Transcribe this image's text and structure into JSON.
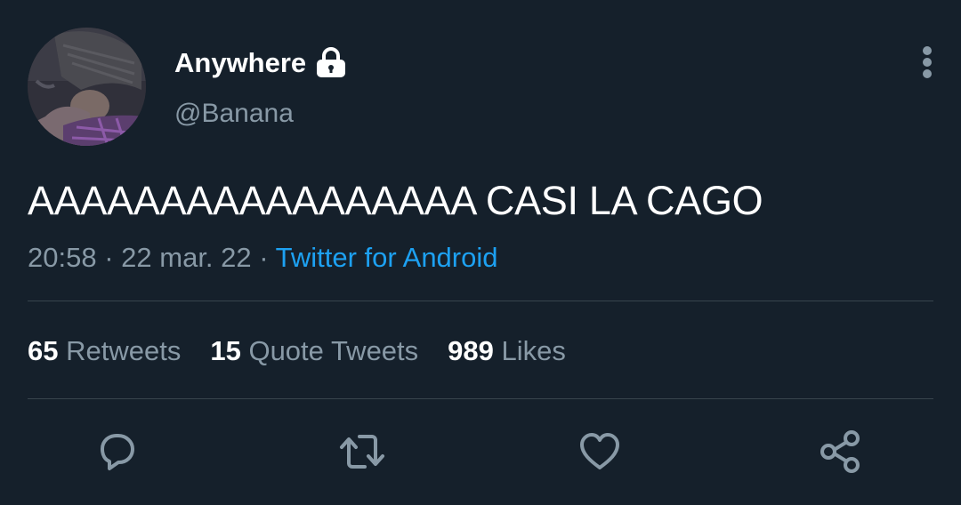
{
  "author": {
    "display_name": "Anywhere",
    "handle": "@Banana",
    "protected_icon": "lock-icon",
    "avatar": "profile-photo"
  },
  "tweet": {
    "text": "AAAAAAAAAAAAAAAAA CASI LA CAGO",
    "time": "20:58",
    "separator": "·",
    "date": "22 mar. 22",
    "source": "Twitter for Android"
  },
  "stats": {
    "retweets_count": "65",
    "retweets_label": "Retweets",
    "quotes_count": "15",
    "quotes_label": "Quote Tweets",
    "likes_count": "989",
    "likes_label": "Likes"
  },
  "actions": {
    "reply_icon": "reply-icon",
    "retweet_icon": "retweet-icon",
    "like_icon": "heart-icon",
    "share_icon": "share-icon",
    "more_icon": "more-vertical-icon"
  },
  "colors": {
    "background": "#15202b",
    "text": "#ffffff",
    "muted": "#8899a6",
    "accent": "#1da1f2",
    "divider": "#38444d"
  }
}
